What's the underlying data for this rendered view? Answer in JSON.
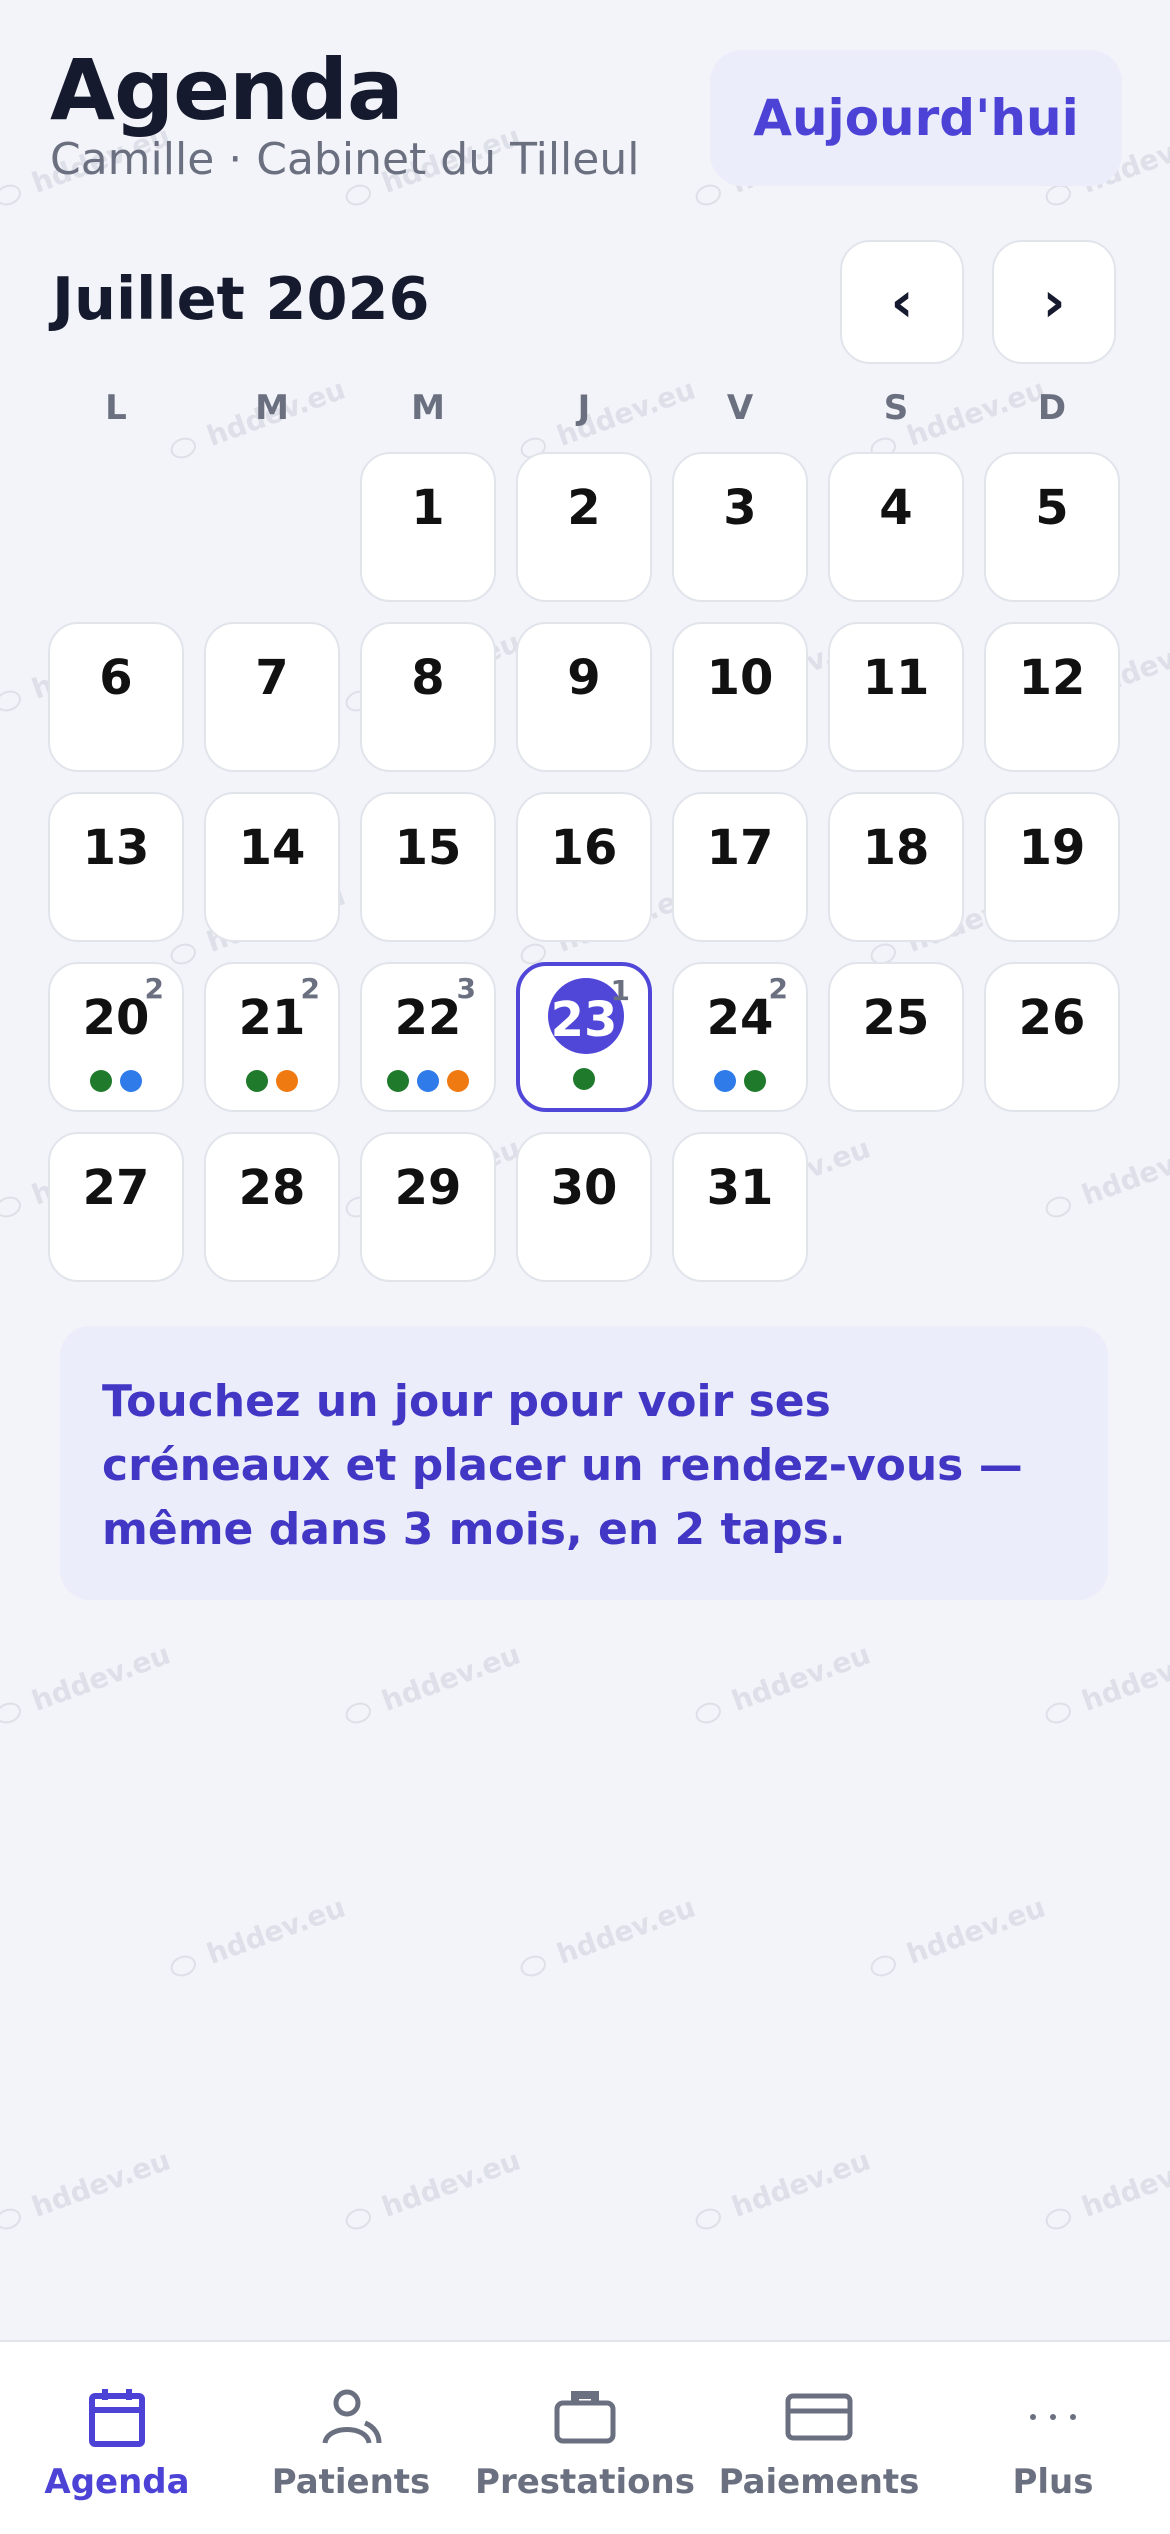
{
  "header": {
    "title": "Agenda",
    "subtitle": "Camille · Cabinet du Tilleul",
    "today_button": "Aujourd'hui"
  },
  "calendar": {
    "month_label": "Juillet 2026",
    "prev_icon": "‹",
    "next_icon": "›",
    "weekdays": [
      "L",
      "M",
      "M",
      "J",
      "V",
      "S",
      "D"
    ],
    "leading_empty": 2,
    "selected_day": 23,
    "days": [
      {
        "n": "1"
      },
      {
        "n": "2"
      },
      {
        "n": "3"
      },
      {
        "n": "4"
      },
      {
        "n": "5"
      },
      {
        "n": "6"
      },
      {
        "n": "7"
      },
      {
        "n": "8"
      },
      {
        "n": "9"
      },
      {
        "n": "10"
      },
      {
        "n": "11"
      },
      {
        "n": "12"
      },
      {
        "n": "13"
      },
      {
        "n": "14"
      },
      {
        "n": "15"
      },
      {
        "n": "16"
      },
      {
        "n": "17"
      },
      {
        "n": "18"
      },
      {
        "n": "19"
      },
      {
        "n": "20",
        "count": "2",
        "dots": [
          "green",
          "blue"
        ]
      },
      {
        "n": "21",
        "count": "2",
        "dots": [
          "green",
          "orange"
        ]
      },
      {
        "n": "22",
        "count": "3",
        "dots": [
          "green",
          "blue",
          "orange"
        ]
      },
      {
        "n": "23",
        "count": "1",
        "dots": [
          "green"
        ]
      },
      {
        "n": "24",
        "count": "2",
        "dots": [
          "blue",
          "green"
        ]
      },
      {
        "n": "25"
      },
      {
        "n": "26"
      },
      {
        "n": "27"
      },
      {
        "n": "28"
      },
      {
        "n": "29"
      },
      {
        "n": "30"
      },
      {
        "n": "31"
      }
    ]
  },
  "hint": "Touchez un jour pour voir ses créneaux et placer un rendez-vous — même dans 3 mois, en 2 taps.",
  "tabs": [
    {
      "label": "Agenda",
      "icon": "calendar-icon",
      "active": true
    },
    {
      "label": "Patients",
      "icon": "user-icon",
      "active": false
    },
    {
      "label": "Prestations",
      "icon": "briefcase-icon",
      "active": false
    },
    {
      "label": "Paiements",
      "icon": "credit-card-icon",
      "active": false
    },
    {
      "label": "Plus",
      "icon": "more-icon",
      "active": false
    }
  ],
  "watermark": "hddev.eu",
  "colors": {
    "accent": "#5047d9",
    "green": "#1f7a2c",
    "blue": "#2f7bea",
    "orange": "#f07a12"
  }
}
